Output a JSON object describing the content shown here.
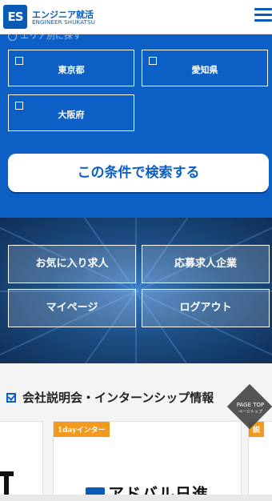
{
  "header": {
    "logo_mark": "ES",
    "logo_jp": "エンジニア就活",
    "logo_en": "ENGINEER SHUKATSU",
    "menu_icon": "hamburger-icon"
  },
  "search": {
    "hint_text": "エリア別に探す",
    "prefectures": [
      "東京都",
      "愛知県",
      "大阪府"
    ],
    "submit_label": "この条件で検索する"
  },
  "quick_links": [
    "お気に入り求人",
    "応募求人企業",
    "マイページ",
    "ログアウト"
  ],
  "events": {
    "title": "会社説明会・インターンシップ情報",
    "card_tags": [
      "1dayインター",
      "説"
    ],
    "company_logo_text": "アドバル日進"
  },
  "page_top": {
    "label": "PAGE TOP",
    "sub": "ページトップ"
  },
  "colors": {
    "brand_blue": "#0c5fc4",
    "tag_orange": "#f39a1e"
  }
}
